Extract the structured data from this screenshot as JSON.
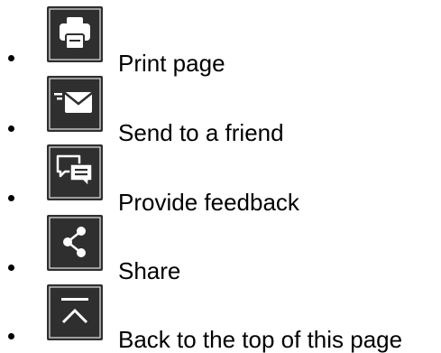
{
  "colors": {
    "icon_background": "#333333",
    "icon_foreground": "#ffffff",
    "text": "#000000"
  },
  "actions": [
    {
      "icon": "printer-icon",
      "label": "Print page"
    },
    {
      "icon": "envelope-icon",
      "label": "Send to a friend"
    },
    {
      "icon": "chat-bubbles-icon",
      "label": "Provide feedback"
    },
    {
      "icon": "share-icon",
      "label": "Share"
    },
    {
      "icon": "back-to-top-icon",
      "label": "Back to the top of this page"
    }
  ]
}
